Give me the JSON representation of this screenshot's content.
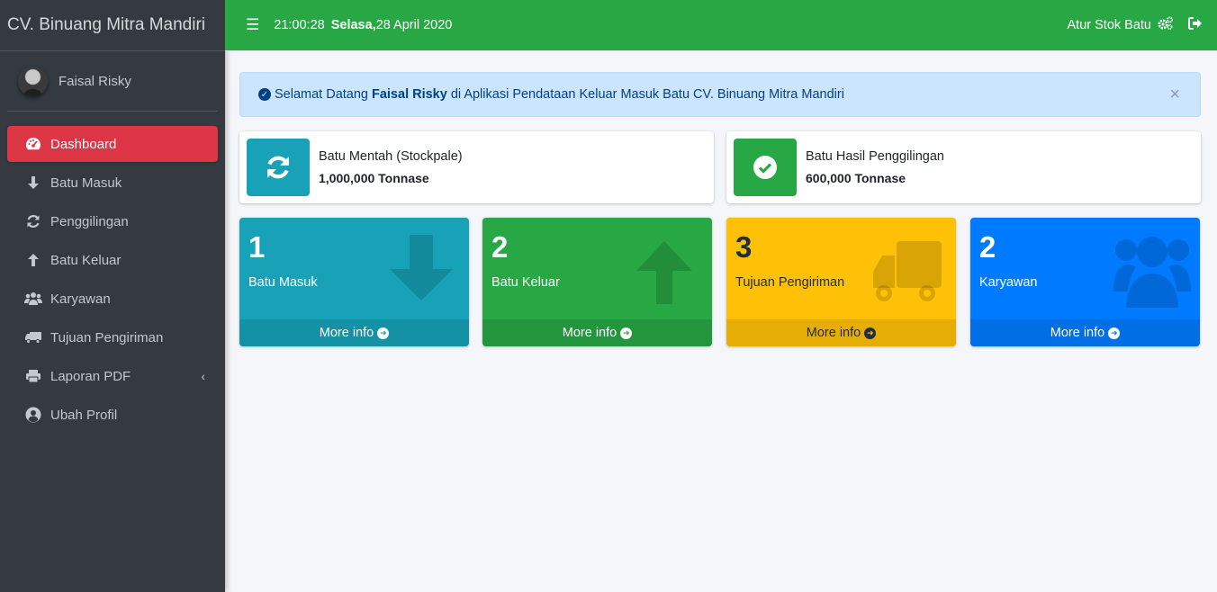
{
  "brand": "CV. Binuang Mitra Mandiri",
  "user": {
    "name": "Faisal Risky"
  },
  "sidebar": {
    "items": [
      {
        "label": "Dashboard",
        "icon": "tachometer-icon",
        "active": true
      },
      {
        "label": "Batu Masuk",
        "icon": "arrow-down-icon"
      },
      {
        "label": "Penggilingan",
        "icon": "refresh-icon"
      },
      {
        "label": "Batu Keluar",
        "icon": "arrow-up-icon"
      },
      {
        "label": "Karyawan",
        "icon": "users-icon"
      },
      {
        "label": "Tujuan Pengiriman",
        "icon": "truck-icon"
      },
      {
        "label": "Laporan PDF",
        "icon": "print-icon"
      },
      {
        "label": "Ubah Profil",
        "icon": "user-circle-icon"
      }
    ]
  },
  "navbar": {
    "time": "21:00:28",
    "day": "Selasa,",
    "date": " 28 April 2020",
    "stock_link": "Atur Stok Batu"
  },
  "alert": {
    "prefix": "Selamat Datang",
    "name": "Faisal Risky",
    "suffix": "di Aplikasi Pendataan Keluar Masuk Batu CV. Binuang Mitra Mandiri",
    "close": "×"
  },
  "info_boxes": [
    {
      "label": "Batu Mentah (Stockpale)",
      "value": "1,000,000 Tonnase",
      "color": "#17a2b8"
    },
    {
      "label": "Batu Hasil Penggilingan",
      "value": "600,000 Tonnase",
      "color": "#28a745"
    }
  ],
  "small_boxes": [
    {
      "number": "1",
      "label": "Batu Masuk",
      "footer": "More info",
      "color": "#17a2b8",
      "icon": "arrow-down-icon"
    },
    {
      "number": "2",
      "label": "Batu Keluar",
      "footer": "More info",
      "color": "#28a745",
      "icon": "arrow-up-icon"
    },
    {
      "number": "3",
      "label": "Tujuan Pengiriman",
      "footer": "More info",
      "color": "#ffc107",
      "icon": "truck-icon"
    },
    {
      "number": "2",
      "label": "Karyawan",
      "footer": "More info",
      "color": "#007bff",
      "icon": "users-icon"
    }
  ]
}
